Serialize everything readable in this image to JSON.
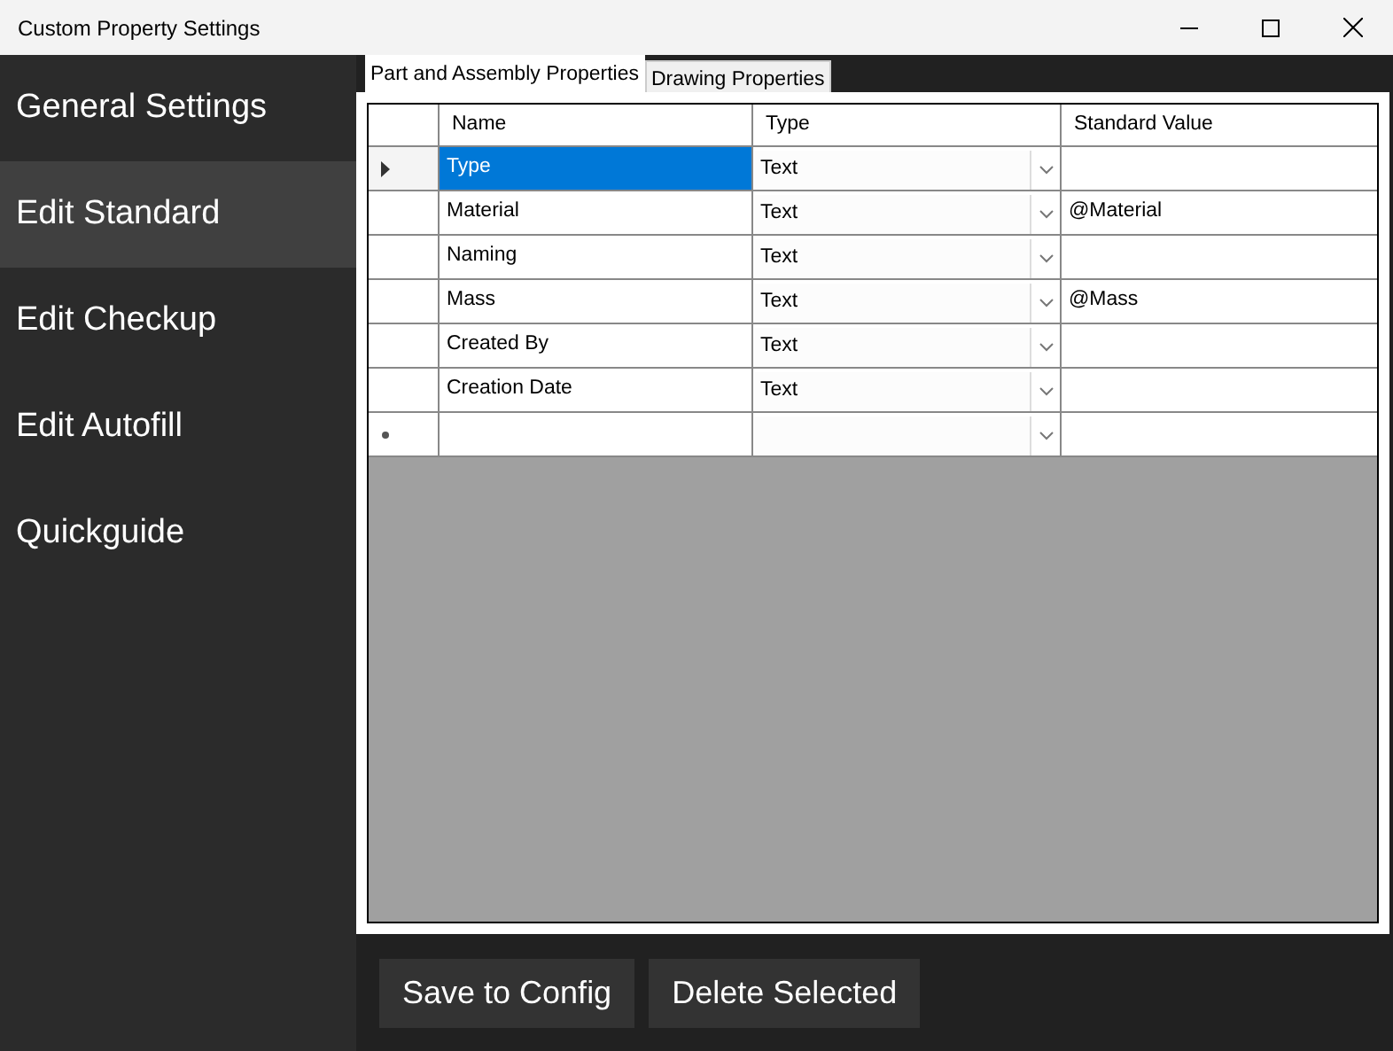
{
  "window": {
    "title": "Custom Property Settings"
  },
  "sidebar": {
    "items": [
      {
        "label": "General Settings",
        "selected": false
      },
      {
        "label": "Edit Standard",
        "selected": true
      },
      {
        "label": "Edit Checkup",
        "selected": false
      },
      {
        "label": "Edit Autofill",
        "selected": false
      },
      {
        "label": "Quickguide",
        "selected": false
      }
    ]
  },
  "tabs": [
    {
      "label": "Part and Assembly Properties",
      "selected": true
    },
    {
      "label": "Drawing Properties",
      "selected": false
    }
  ],
  "table": {
    "columns": [
      "Name",
      "Type",
      "Standard Value"
    ],
    "rows": [
      {
        "kind": "data",
        "name": "Type",
        "type": "Text",
        "selected": true
      },
      {
        "kind": "data",
        "name": "Material",
        "type": "Text",
        "standard_value": "@Material",
        "selected": false
      },
      {
        "kind": "data",
        "name": "Naming",
        "type": "Text",
        "selected": false
      },
      {
        "kind": "data",
        "name": "Mass",
        "type": "Text",
        "standard_value": "@Mass",
        "selected": false
      },
      {
        "kind": "data",
        "name": "Created By",
        "type": "Text",
        "selected": false
      },
      {
        "kind": "data",
        "name": "Creation Date",
        "type": "Text",
        "selected": false
      },
      {
        "kind": "new",
        "selected": false
      }
    ]
  },
  "buttons": [
    "Save to Config",
    "Delete Selected"
  ]
}
